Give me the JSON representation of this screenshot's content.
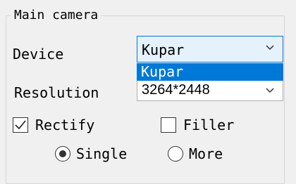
{
  "group": {
    "title": "Main camera"
  },
  "device": {
    "label": "Device",
    "selected": "Kupar",
    "dropdown_highlighted_item": "Kupar"
  },
  "resolution": {
    "label": "Resolution",
    "selected": "3264*2448"
  },
  "options": {
    "rectify": {
      "label": "Rectify",
      "checked": true
    },
    "filler": {
      "label": "Filler",
      "checked": false
    }
  },
  "mode": {
    "single": {
      "label": "Single",
      "selected": true
    },
    "more": {
      "label": "More",
      "selected": false
    }
  },
  "colors": {
    "accent": "#0078d7",
    "focus_fill": "#e5f1fb",
    "window_bg": "#f0f0f0"
  }
}
